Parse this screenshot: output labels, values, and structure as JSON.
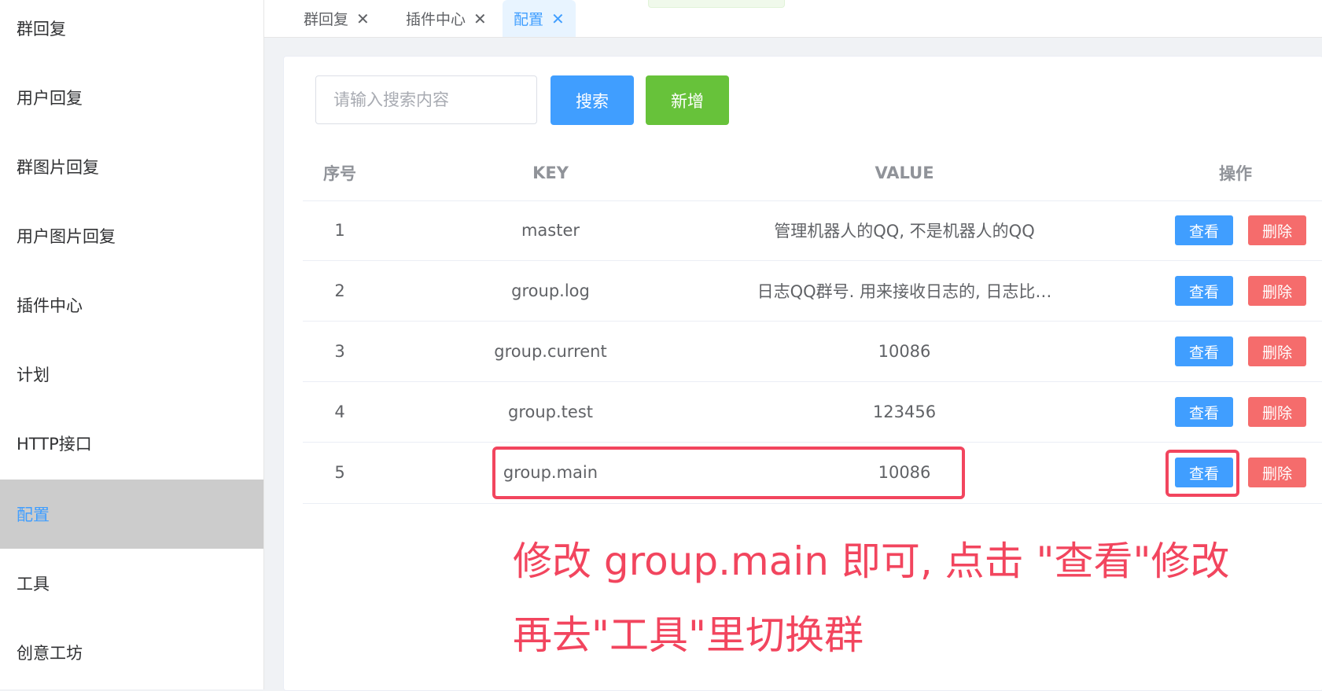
{
  "sidebar": {
    "items": [
      {
        "label": "群回复"
      },
      {
        "label": "用户回复"
      },
      {
        "label": "群图片回复"
      },
      {
        "label": "用户图片回复"
      },
      {
        "label": "插件中心"
      },
      {
        "label": "计划"
      },
      {
        "label": "HTTP接口"
      },
      {
        "label": "配置"
      },
      {
        "label": "工具"
      },
      {
        "label": "创意工坊"
      }
    ],
    "active": "配置"
  },
  "tabs": [
    {
      "label": "群回复",
      "close_icon": "close-icon"
    },
    {
      "label": "插件中心",
      "close_icon": "close-icon"
    },
    {
      "label": "配置",
      "close_icon": "close-icon",
      "active": true
    }
  ],
  "toolbar": {
    "search_placeholder": "请输入搜索内容",
    "search_label": "搜索",
    "add_label": "新增"
  },
  "table": {
    "headers": {
      "index": "序号",
      "key": "KEY",
      "value": "VALUE",
      "ops": "操作"
    },
    "view_label": "查看",
    "delete_label": "删除",
    "rows": [
      {
        "index": "1",
        "key": "master",
        "value": "管理机器人的QQ, 不是机器人的QQ"
      },
      {
        "index": "2",
        "key": "group.log",
        "value": "日志QQ群号. 用来接收日志的, 日志比…"
      },
      {
        "index": "3",
        "key": "group.current",
        "value": "10086"
      },
      {
        "index": "4",
        "key": "group.test",
        "value": "123456"
      },
      {
        "index": "5",
        "key": "group.main",
        "value": "10086"
      }
    ]
  },
  "annotation": {
    "line1": "修改 group.main 即可, 点击 \"查看\"修改",
    "line2": "再去\"工具\"里切换群",
    "color": "#f2455e"
  },
  "colors": {
    "primary": "#409eff",
    "success": "#67c23a",
    "danger": "#f56c6c",
    "sidebar_active_bg": "#cccccc"
  }
}
